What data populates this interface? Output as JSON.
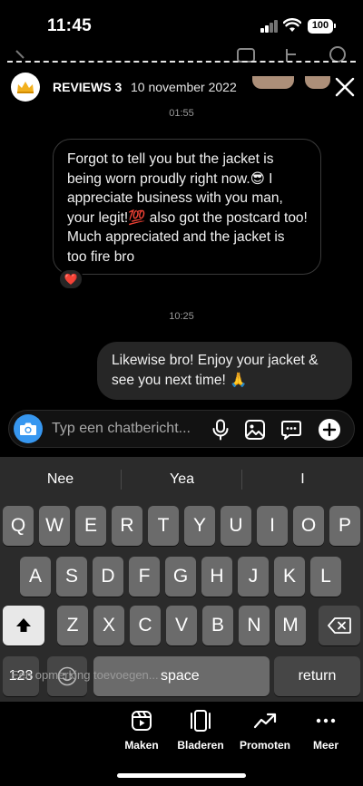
{
  "status_bar": {
    "time": "11:45",
    "battery": "100"
  },
  "story": {
    "username": "REVIEWS 3",
    "date": "10 november 2022",
    "close_icon": "close-icon"
  },
  "chat": {
    "time_1": "01:55",
    "incoming_message": "Forgot to tell you but the jacket is being worn proudly right now.😎 I appreciate business with you man, your legit!💯 also got the postcard too! Much appreciated and the jacket is too fire bro",
    "reaction": "❤️",
    "time_2": "10:25",
    "outgoing_message": "Likewise bro! Enjoy your jacket & see you next time! 🙏"
  },
  "composer": {
    "placeholder": "Typ een chatbericht...",
    "camera_icon": "camera-icon",
    "mic_icon": "microphone-icon",
    "gallery_icon": "gallery-icon",
    "sticker_icon": "sticker-icon",
    "plus_icon": "plus-icon",
    "accent": "#3797f0"
  },
  "keyboard": {
    "suggestions": [
      "Nee",
      "Yea",
      "I"
    ],
    "row1": [
      "Q",
      "W",
      "E",
      "R",
      "T",
      "Y",
      "U",
      "I",
      "O",
      "P"
    ],
    "row2": [
      "A",
      "S",
      "D",
      "F",
      "G",
      "H",
      "J",
      "K",
      "L"
    ],
    "row3": [
      "Z",
      "X",
      "C",
      "V",
      "B",
      "N",
      "M"
    ],
    "numbers_key": "123",
    "space_key": "space",
    "return_key": "return",
    "overlay_text": "Een opmerking toevoegen..."
  },
  "bottom_tabs": [
    {
      "label": "Maken",
      "icon": "reels-icon"
    },
    {
      "label": "Bladeren",
      "icon": "pages-icon"
    },
    {
      "label": "Promoten",
      "icon": "trend-icon"
    },
    {
      "label": "Meer",
      "icon": "more-icon"
    }
  ]
}
